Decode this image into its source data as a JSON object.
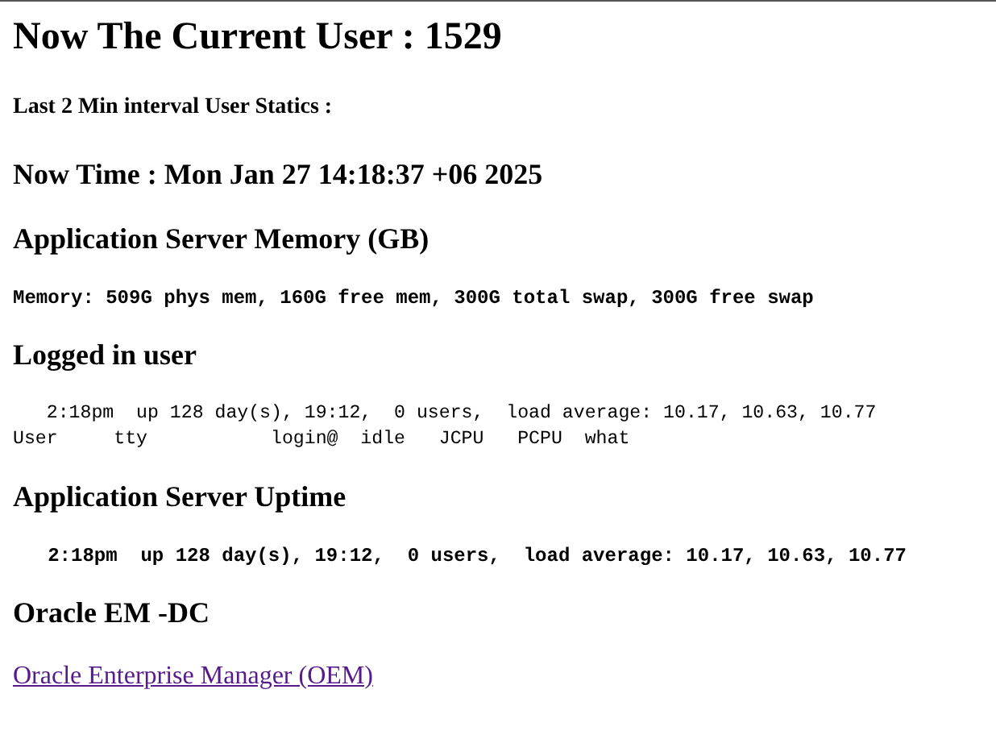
{
  "blocks": [
    {
      "kind": "title",
      "text": "Now The Current User : 1529"
    },
    {
      "kind": "subheading",
      "text": "Last 2 Min interval User Statics :"
    },
    {
      "kind": "heading",
      "text": "Now Time : Mon Jan 27 14:18:37 +06 2025"
    },
    {
      "kind": "heading",
      "text": "Application Server Memory (GB)"
    },
    {
      "kind": "console_bold",
      "lines": [
        "Memory: 509G phys mem, 160G free mem, 300G total swap, 300G free swap"
      ]
    },
    {
      "kind": "heading",
      "text": "Logged in user"
    },
    {
      "kind": "console",
      "lines": [
        "   2:18pm  up 128 day(s), 19:12,  0 users,  load average: 10.17, 10.63, 10.77",
        "User     tty           login@  idle   JCPU   PCPU  what"
      ]
    },
    {
      "kind": "heading",
      "text": "Application Server Uptime"
    },
    {
      "kind": "console_bold",
      "lines": [
        "   2:18pm  up 128 day(s), 19:12,  0 users,  load average: 10.17, 10.63, 10.77"
      ]
    },
    {
      "kind": "heading",
      "text": "Oracle EM -DC"
    },
    {
      "kind": "link",
      "text": "Oracle Enterprise Manager (OEM)"
    }
  ]
}
